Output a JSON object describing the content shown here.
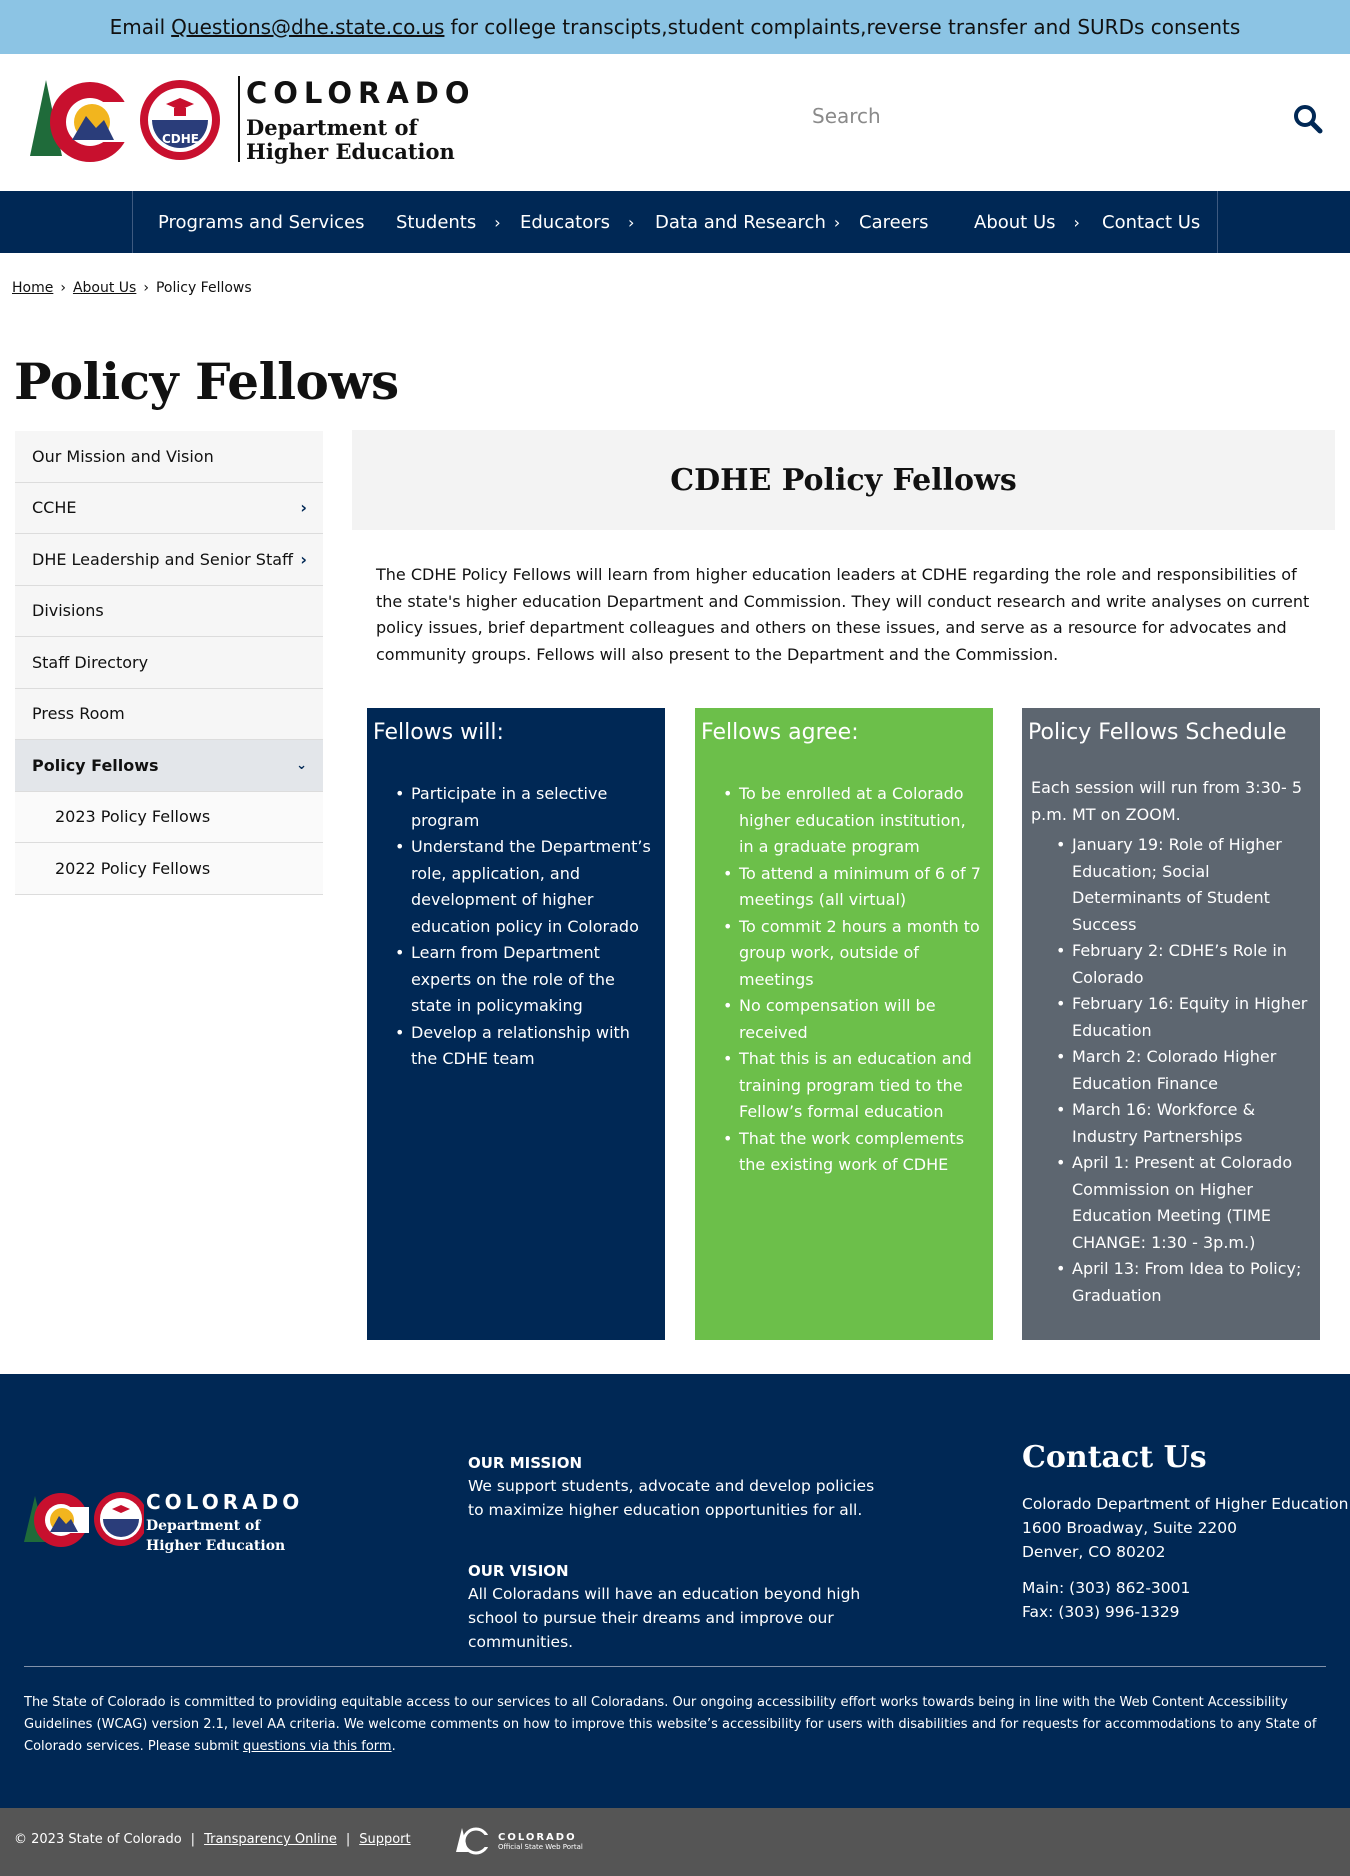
{
  "alert": {
    "prefix": "Email",
    "email": "Questions@dhe.state.co.us",
    "suffix": "for college transcipts,student complaints,reverse transfer and SURDs consents"
  },
  "header": {
    "logo_state": "COLORADO",
    "logo_dept_line1": "Department of",
    "logo_dept_line2": "Higher Education",
    "logo_badge": "CDHE",
    "search_placeholder": "Search"
  },
  "nav": {
    "items": [
      {
        "label": "Programs and Services"
      },
      {
        "label": "Students"
      },
      {
        "label": "Educators"
      },
      {
        "label": "Data and Research"
      },
      {
        "label": "Careers"
      },
      {
        "label": "About Us"
      },
      {
        "label": "Contact Us"
      }
    ],
    "chevron": "›"
  },
  "breadcrumb": {
    "home": "Home",
    "about": "About Us",
    "current": "Policy Fellows",
    "sep": "›"
  },
  "page_title": "Policy Fellows",
  "sidebar": {
    "items": [
      {
        "label": "Our Mission and Vision"
      },
      {
        "label": "CCHE"
      },
      {
        "label": "DHE Leadership and Senior Staff"
      },
      {
        "label": "Divisions"
      },
      {
        "label": "Staff Directory"
      },
      {
        "label": "Press Room"
      },
      {
        "label": "Policy Fellows"
      },
      {
        "label": "2023 Policy Fellows"
      },
      {
        "label": "2022 Policy Fellows"
      }
    ]
  },
  "main": {
    "hero_title": "CDHE Policy Fellows",
    "intro": "The CDHE Policy Fellows will learn from higher education leaders at CDHE regarding the role and responsibilities of the state's higher education Department and Commission. They will conduct research and write analyses on current policy issues, brief department colleagues and others on these issues, and serve as a resource for advocates and community groups. Fellows will also present to the Department and the Commission.",
    "cards": [
      {
        "title": "Fellows will:",
        "items": [
          "Participate in a selective program",
          "Understand the Department’s role, application, and development of higher education policy in Colorado",
          "Learn from Department experts on the role of the state in policymaking",
          "Develop a relationship with the CDHE team"
        ]
      },
      {
        "title": "Fellows agree:",
        "items": [
          "To be enrolled at a Colorado higher education institution, in a graduate program",
          "To attend a minimum of 6 of 7 meetings (all virtual)",
          "To commit 2 hours a month to group work, outside of meetings",
          "No compensation will be received",
          "That this is an education and training program tied to the Fellow’s formal education",
          "That the work complements the existing work of CDHE"
        ]
      },
      {
        "title": "Policy Fellows Schedule",
        "lead": "Each session will run from 3:30- 5 p.m. MT on ZOOM.",
        "items": [
          "January 19: Role of Higher Education; Social Determinants of Student Success",
          "February 2: CDHE’s Role in Colorado",
          "February 16: Equity in Higher Education",
          "March 2: Colorado Higher Education Finance",
          "March 16: Workforce & Industry Partnerships",
          "April 1: Present at Colorado Commission on Higher Education Meeting (TIME CHANGE: 1:30 - 3p.m.)",
          "April 13: From Idea to Policy; Graduation"
        ]
      }
    ]
  },
  "footer": {
    "mission_head": "OUR MISSION",
    "mission_text": "We support students, advocate and develop policies to maximize higher education opportunities for all.",
    "vision_head": "OUR VISION",
    "vision_text": "All Coloradans will have an education beyond high school to pursue their dreams and improve our communities.",
    "contact_title": "Contact Us",
    "contact_line1": "Colorado Department of Higher Education",
    "contact_line2": "1600 Broadway, Suite 2200",
    "contact_line3": "Denver, CO 80202",
    "main_phone": "Main: (303) 862-3001",
    "fax": "Fax: (303) 996-1329",
    "accessibility": "The State of Colorado is committed to providing equitable access to our services to all Coloradans. Our ongoing accessibility effort works towards being in line with the Web Content Accessibility Guidelines (WCAG) version 2.1, level AA criteria. We welcome comments on how to improve this website’s accessibility for users with disabilities and for requests for accommodations to any State of Colorado services. Please submit",
    "accessibility_link": "questions via this form",
    "accessibility_end": "."
  },
  "bottom": {
    "copyright": "© 2023 State of Colorado",
    "transparency": "Transparency Online",
    "support": "Support",
    "portal_line1": "COLORADO",
    "portal_line2": "Official State Web Portal"
  },
  "colors": {
    "navy": "#002855",
    "green": "#6cbf4a",
    "slate": "#5d6670",
    "alert_blue": "#8cc4e4"
  }
}
